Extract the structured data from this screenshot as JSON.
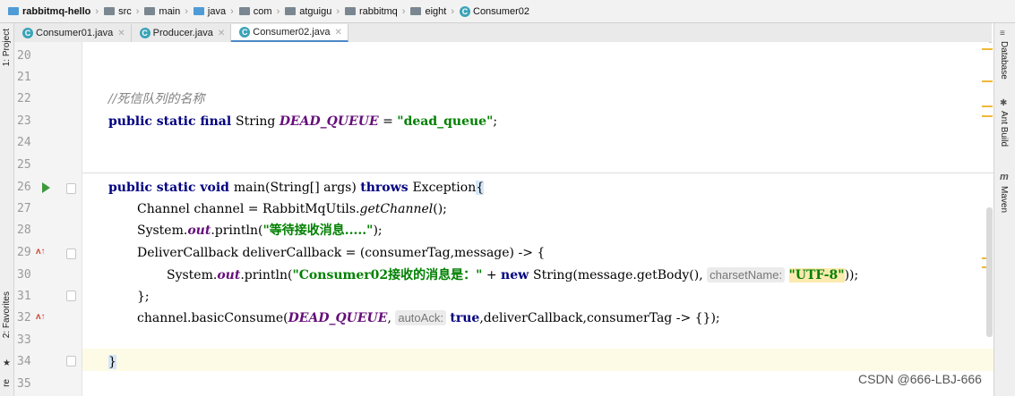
{
  "breadcrumb": [
    "rabbitmq-hello",
    "src",
    "main",
    "java",
    "com",
    "atguigu",
    "rabbitmq",
    "eight",
    "Consumer02"
  ],
  "tabs": [
    {
      "label": "Consumer01.java",
      "active": false
    },
    {
      "label": "Producer.java",
      "active": false
    },
    {
      "label": "Consumer02.java",
      "active": true
    }
  ],
  "left_tools": {
    "project": "1: Project",
    "favorites": "2: Favorites",
    "structure": "re"
  },
  "right_tools": {
    "database": "Database",
    "ant": "Ant Build",
    "maven": "Maven"
  },
  "line_numbers": [
    "20",
    "21",
    "22",
    "23",
    "24",
    "25",
    "26",
    "27",
    "28",
    "29",
    "30",
    "31",
    "32",
    "33",
    "34",
    "35"
  ],
  "code": {
    "l22_comment": "//死信队列的名称",
    "l23_a": "public static final ",
    "l23_b": "String ",
    "l23_c": "DEAD_QUEUE",
    "l23_d": " = ",
    "l23_e": "\"dead_queue\"",
    "l23_f": ";",
    "l26_a": "public static void ",
    "l26_b": "main(String[] args) ",
    "l26_c": "throws ",
    "l26_d": "Exception",
    "l26_e": "{",
    "l27_a": "Channel channel = RabbitMqUtils.",
    "l27_b": "getChannel",
    "l27_c": "();",
    "l28_a": "System.",
    "l28_b": "out",
    "l28_c": ".println(",
    "l28_d": "\"等待接收消息.....\"",
    "l28_e": ");",
    "l29": "DeliverCallback deliverCallback = (consumerTag,message) -> {",
    "l30_a": "System.",
    "l30_b": "out",
    "l30_c": ".println(",
    "l30_d": "\"Consumer02接收的消息是：\"",
    "l30_e": " + ",
    "l30_f": "new ",
    "l30_g": "String(message.getBody(), ",
    "l30_hint": "charsetName:",
    "l30_h": "\"UTF-8\"",
    "l30_i": "));",
    "l31": "};",
    "l32_a": "channel.basicConsume(",
    "l32_b": "DEAD_QUEUE",
    "l32_c": ", ",
    "l32_hint": "autoAck:",
    "l32_d": "true",
    "l32_e": ",deliverCallback,consumerTag -> {});",
    "l34": "}"
  },
  "watermark": "CSDN @666-LBJ-666",
  "colors": {
    "keyword": "#000080",
    "string": "#008000",
    "constant": "#660e7a",
    "comment": "#808080"
  }
}
